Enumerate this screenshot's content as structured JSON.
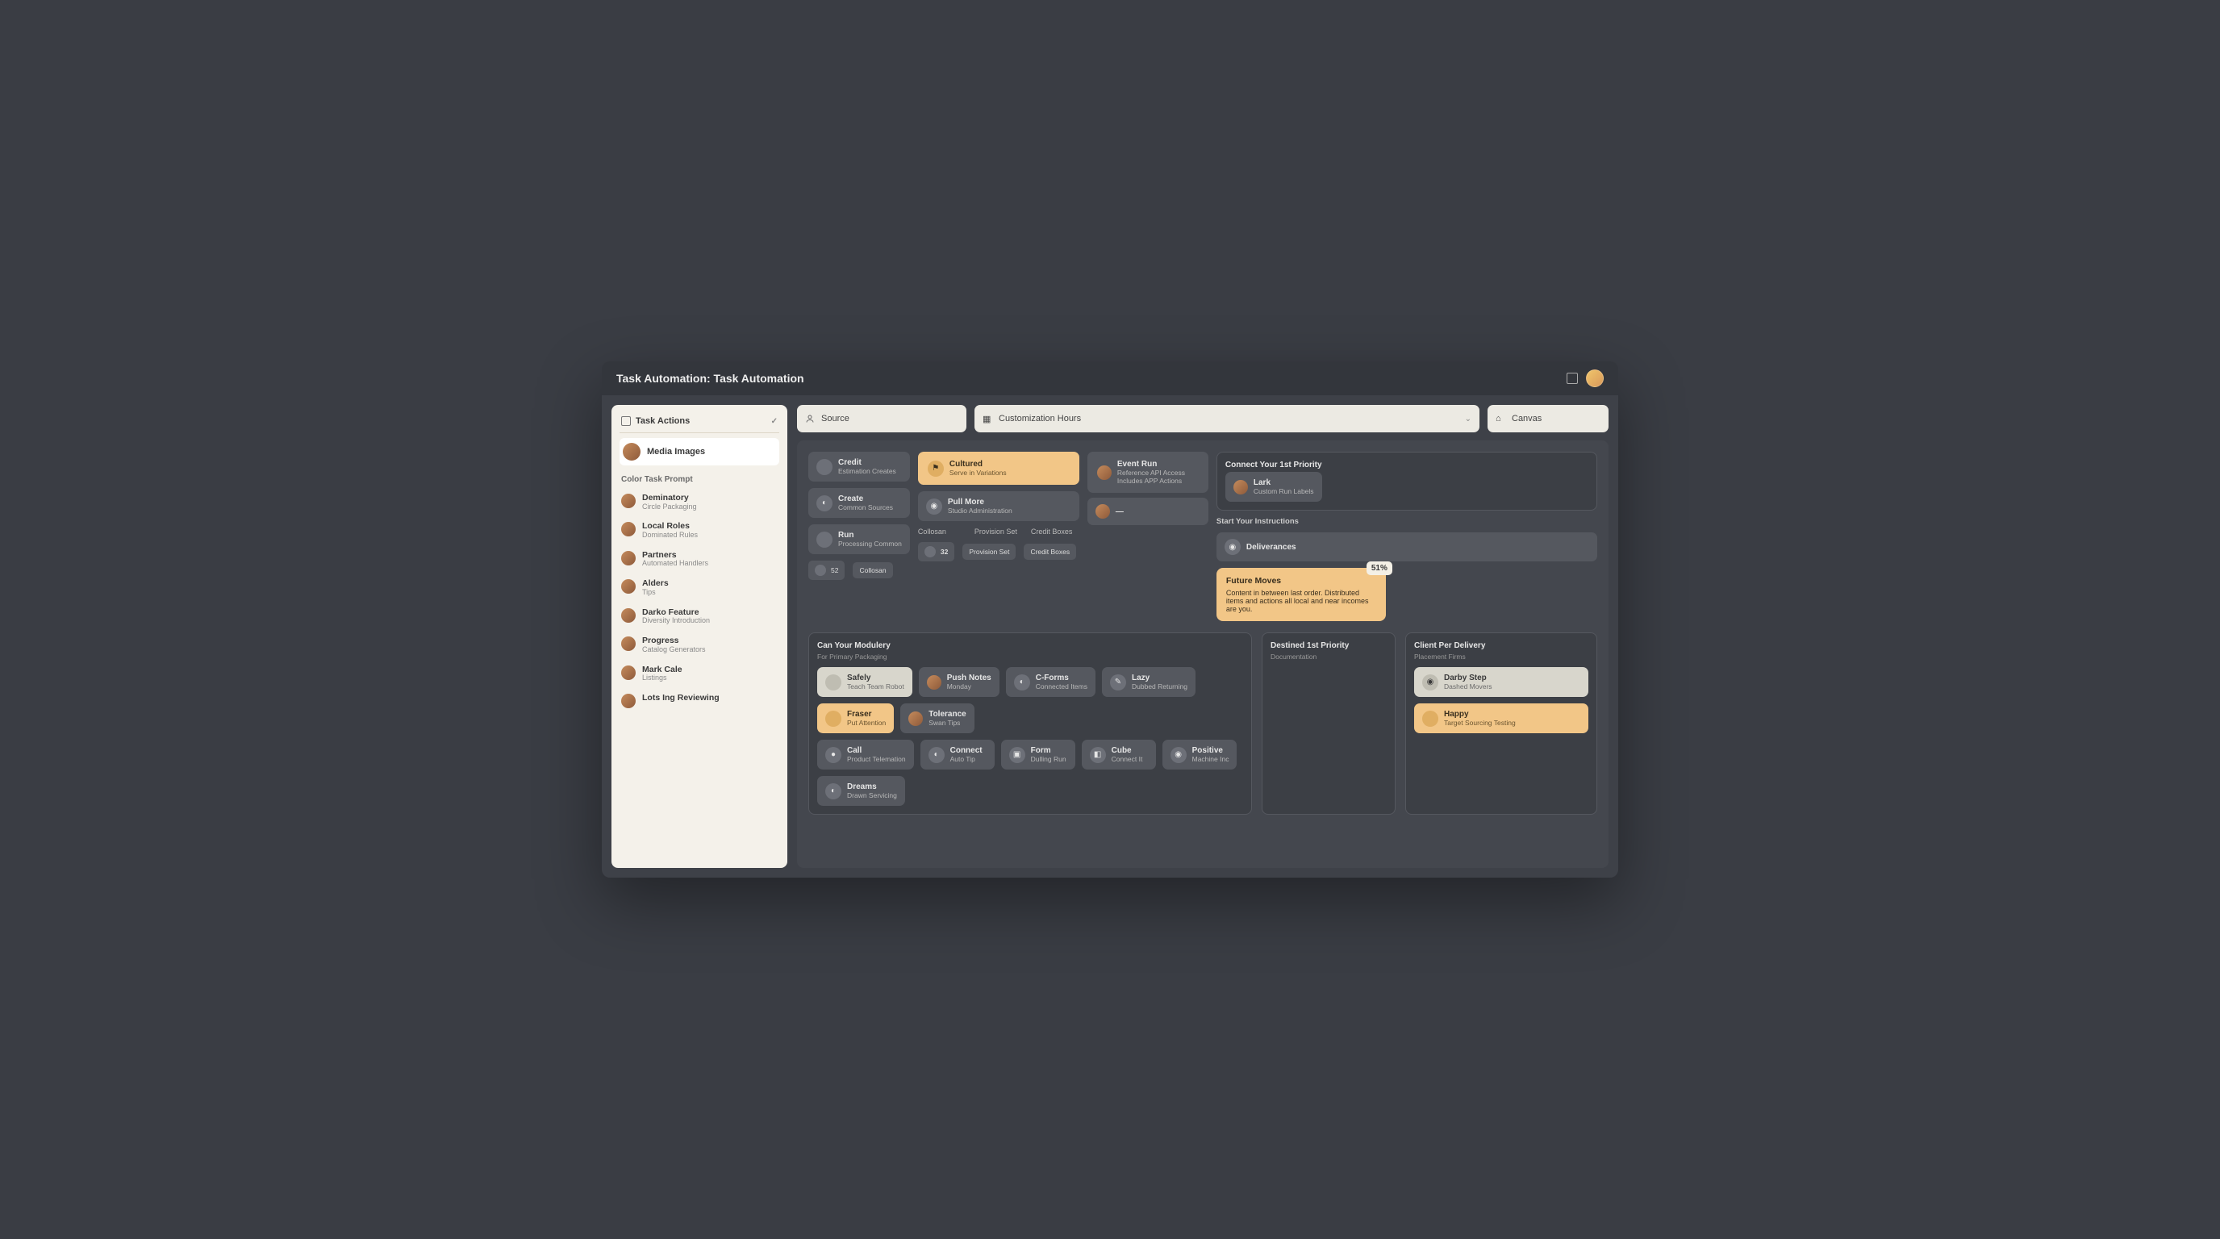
{
  "titlebar": {
    "title": "Task Automation: Task Automation"
  },
  "sidebar": {
    "header": "Task Actions",
    "user": "Media Images",
    "section": "Color Task Prompt",
    "items": [
      {
        "t": "Deminatory",
        "s": "Circle Packaging"
      },
      {
        "t": "Local Roles",
        "s": "Dominated Rules"
      },
      {
        "t": "Partners",
        "s": "Automated Handlers"
      },
      {
        "t": "Alders",
        "s": "Tips"
      },
      {
        "t": "Darko Feature",
        "s": "Diversity Introduction"
      },
      {
        "t": "Progress",
        "s": "Catalog Generators"
      },
      {
        "t": "Mark Cale",
        "s": "Listings"
      },
      {
        "t": "Lots Ing Reviewing",
        "s": ""
      }
    ]
  },
  "toolbar": {
    "box1": "Source",
    "box2": "Customization Hours",
    "box3": "Canvas"
  },
  "canvas": {
    "top": {
      "n1": {
        "t": "Credit",
        "s": "Estimation Creates"
      },
      "n2": {
        "t": "Cultured",
        "s": "Serve in Variations"
      },
      "n3": {
        "t": "Event Run",
        "s": "Reference API Access",
        "s2": "Includes APP Actions"
      },
      "clusterTitle": "Connect Your 1st Priority",
      "clusterItem": {
        "t": "Lark",
        "s": "Custom Run Labels"
      }
    },
    "mid": {
      "a1": {
        "t": "Create",
        "s": "Common Sources"
      },
      "a2": {
        "t": "Pull More",
        "s": "Studio Administration"
      },
      "a3": {
        "t": "Run",
        "s": "Processing Common"
      },
      "stat1": "52",
      "statLabels": {
        "a": "Collosan",
        "b": "Provision Set",
        "c": "Credit Boxes"
      },
      "right": {
        "h": "Start Your Instructions",
        "item": {
          "t": "Deliverances"
        }
      },
      "big": {
        "t": "Future Moves",
        "body": "Content in between last order. Distributed items and actions all local and near incomes are you.",
        "badge": "51%"
      }
    },
    "clusters": [
      {
        "h": "Can Your Modulery",
        "s": "For Primary Packaging",
        "nodes": [
          {
            "t": "Safely",
            "s": "Teach Team Robot",
            "light": true
          },
          {
            "t": "Push Notes",
            "s": "Monday"
          },
          {
            "t": "C-Forms",
            "s": "Connected Items"
          },
          {
            "t": "Lazy",
            "s": "Dubbed Returning"
          },
          {
            "t": "Fraser",
            "s": "Put Attention",
            "hi": true
          },
          {
            "t": "Tolerance",
            "s": "Swan Tips"
          }
        ],
        "nodes2": [
          {
            "t": "Call",
            "s": "Product Telemation"
          },
          {
            "t": "Connect",
            "s": "Auto Tip"
          },
          {
            "t": "Form",
            "s": "Dulling Run"
          },
          {
            "t": "Cube",
            "s": "Connect It"
          },
          {
            "t": "Positive",
            "s": "Machine Inc"
          },
          {
            "t": "Dreams",
            "s": "Drawn Servicing"
          }
        ]
      },
      {
        "h": "Destined 1st Priority",
        "s": "Documentation"
      },
      {
        "h": "Client Per Delivery",
        "s": "Placement Firms",
        "nodes": [
          {
            "t": "Darby Step",
            "s": "Dashed Movers",
            "light": true
          },
          {
            "t": "Happy",
            "s": "Target Sourcing Testing",
            "hi": true
          }
        ]
      }
    ]
  }
}
